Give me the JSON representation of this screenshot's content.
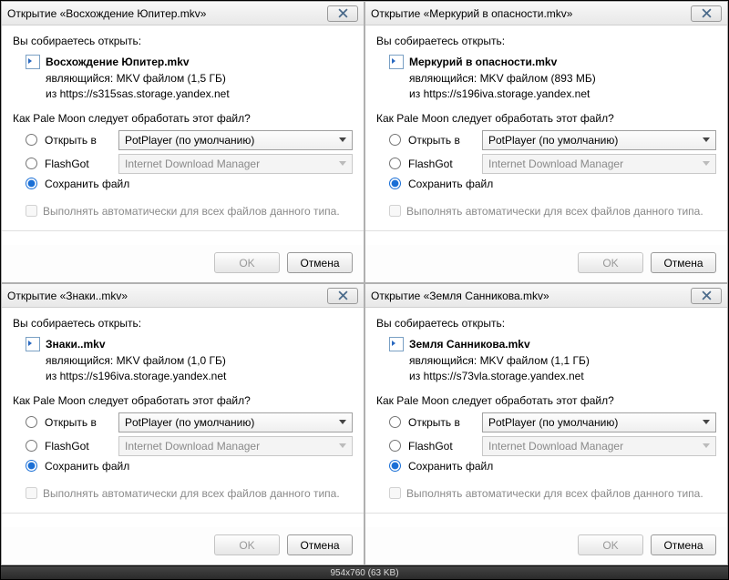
{
  "common": {
    "prompt": "Вы собираетесь открыть:",
    "is_label": "являющийся:",
    "from_label": "из",
    "how_label": "Как Pale Moon следует обработать этот файл?",
    "open_in": "Открыть в",
    "flashgot": "FlashGot",
    "save_file": "Сохранить файл",
    "auto_label": "Выполнять автоматически для всех файлов данного типа.",
    "open_in_value": "PotPlayer (по умолчанию)",
    "flashgot_value": "Internet Download Manager",
    "ok": "OK",
    "cancel": "Отмена"
  },
  "dialogs": [
    {
      "title": "Открытие «Восхождение Юпитер.mkv»",
      "filename": "Восхождение Юпитер.mkv",
      "filetype": "MKV файлом (1,5 ГБ)",
      "source": "https://s315sas.storage.yandex.net"
    },
    {
      "title": "Открытие «Меркурий в опасности.mkv»",
      "filename": "Меркурий в опасности.mkv",
      "filetype": "MKV файлом (893 МБ)",
      "source": "https://s196iva.storage.yandex.net"
    },
    {
      "title": "Открытие «Знаки..mkv»",
      "filename": "Знаки..mkv",
      "filetype": "MKV файлом (1,0 ГБ)",
      "source": "https://s196iva.storage.yandex.net"
    },
    {
      "title": "Открытие «Земля Санникова.mkv»",
      "filename": "Земля Санникова.mkv",
      "filetype": "MKV файлом (1,1 ГБ)",
      "source": "https://s73vla.storage.yandex.net"
    }
  ],
  "statusbar": "954x760 (63 KB)"
}
